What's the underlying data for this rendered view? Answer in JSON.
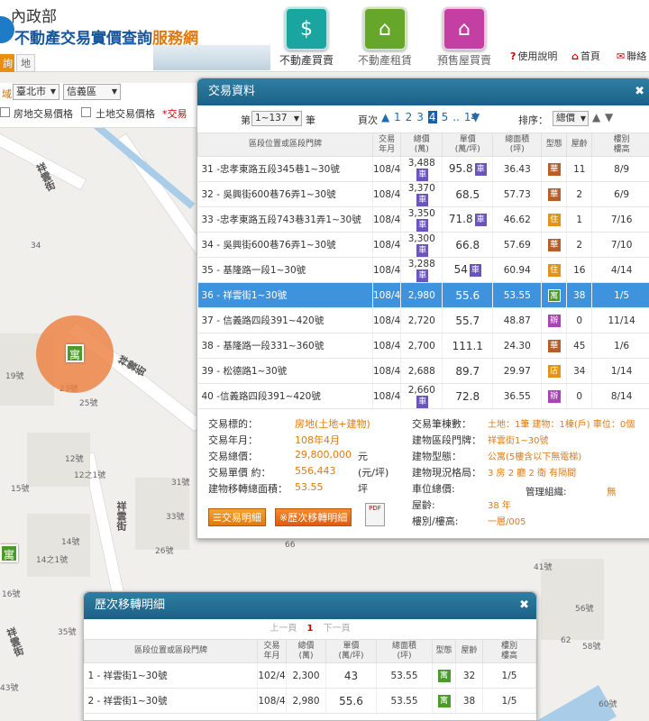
{
  "header": {
    "ministry": "內政部",
    "title_main": "不動產交易實價查詢",
    "title_accent": "服務網",
    "nav": [
      {
        "label": "不動產買賣",
        "color": "#1aa5a0",
        "icon": "building-dollar-icon",
        "glyph": "$"
      },
      {
        "label": "不動產租賃",
        "color": "#66a62b",
        "icon": "house-rent-icon",
        "glyph": "⌂"
      },
      {
        "label": "預售屋買賣",
        "color": "#c43fa4",
        "icon": "presale-crane-icon",
        "glyph": "⌂"
      }
    ],
    "links": [
      {
        "label": "使用說明",
        "glyph": "?"
      },
      {
        "label": "首頁",
        "glyph": "⌂"
      },
      {
        "label": "聯絡",
        "glyph": "✉"
      }
    ],
    "tabs": [
      "詢",
      "地標查詢"
    ]
  },
  "controls": {
    "area_label": "域",
    "city": "臺北市",
    "district": "信義區",
    "check1": "房地交易價格",
    "check2": "土地交易價格",
    "note": "*交易"
  },
  "map": {
    "streets": [
      "祥雲街",
      "祥雲街",
      "祥雲街",
      "祥雲街"
    ],
    "numbers": [
      "34",
      "19號",
      "23號",
      "25號",
      "12號",
      "12之1號",
      "15號",
      "31號",
      "33號",
      "14號",
      "14之1號",
      "26號",
      "16號",
      "35號",
      "41號",
      "56號",
      "58號",
      "62",
      "60號",
      "66",
      "43號"
    ]
  },
  "trade": {
    "title": "交易資料",
    "page_prefix": "第",
    "page_range": "1~137",
    "page_suffix": "筆",
    "pager_label": "頁次",
    "pages": [
      "1",
      "2",
      "3",
      "4",
      "5",
      "..",
      "14"
    ],
    "current_page": "4",
    "sort_label": "排序：",
    "sort_value": "總價",
    "columns": [
      "區段位置或區段門牌",
      "交易\n年月",
      "總價\n(萬)",
      "單價\n(萬/坪)",
      "總面積\n(坪)",
      "型態",
      "屋齡",
      "樓別\n樓高"
    ],
    "rows": [
      {
        "addr": "31 -忠孝東路五段345巷1~30號",
        "date": "108/4",
        "total": "3,488",
        "car": true,
        "unit": "95.8",
        "unitcar": true,
        "area": "36.43",
        "type": "華",
        "tcolor": "#b5602a",
        "age": "11",
        "floor": "8/9",
        "sel": false
      },
      {
        "addr": "32 - 吳興街600巷76弄1~30號",
        "date": "108/4",
        "total": "3,370",
        "car": true,
        "unit": "68.5",
        "unitcar": false,
        "area": "57.73",
        "type": "華",
        "tcolor": "#b5602a",
        "age": "2",
        "floor": "6/9",
        "sel": false
      },
      {
        "addr": "33 -忠孝東路五段743巷31弄1~30號",
        "date": "108/4",
        "total": "3,350",
        "car": true,
        "unit": "71.8",
        "unitcar": true,
        "area": "46.62",
        "type": "住",
        "tcolor": "#e0951a",
        "age": "1",
        "floor": "7/16",
        "sel": false
      },
      {
        "addr": "34 - 吳興街600巷76弄1~30號",
        "date": "108/4",
        "total": "3,300",
        "car": true,
        "unit": "66.8",
        "unitcar": false,
        "area": "57.69",
        "type": "華",
        "tcolor": "#b5602a",
        "age": "2",
        "floor": "7/10",
        "sel": false
      },
      {
        "addr": "35 - 基隆路一段1~30號",
        "date": "108/4",
        "total": "3,288",
        "car": true,
        "unit": "54",
        "unitcar": true,
        "area": "60.94",
        "type": "住",
        "tcolor": "#e0951a",
        "age": "16",
        "floor": "4/14",
        "sel": false
      },
      {
        "addr": "36 - 祥雲街1~30號",
        "date": "108/4",
        "total": "2,980",
        "car": false,
        "unit": "55.6",
        "unitcar": false,
        "area": "53.55",
        "type": "寓",
        "tcolor": "#4c9a2a",
        "age": "38",
        "floor": "1/5",
        "sel": true
      },
      {
        "addr": "37 - 信義路四段391~420號",
        "date": "108/4",
        "total": "2,720",
        "car": false,
        "unit": "55.7",
        "unitcar": false,
        "area": "48.87",
        "type": "辦",
        "tcolor": "#a745b0",
        "age": "0",
        "floor": "11/14",
        "sel": false
      },
      {
        "addr": "38 - 基隆路一段331~360號",
        "date": "108/4",
        "total": "2,700",
        "car": false,
        "unit": "111.1",
        "unitcar": false,
        "area": "24.30",
        "type": "華",
        "tcolor": "#b5602a",
        "age": "45",
        "floor": "1/6",
        "sel": false
      },
      {
        "addr": "39 - 松德路1~30號",
        "date": "108/4",
        "total": "2,688",
        "car": false,
        "unit": "89.7",
        "unitcar": false,
        "area": "29.97",
        "type": "店",
        "tcolor": "#e0951a",
        "age": "34",
        "floor": "1/14",
        "sel": false
      },
      {
        "addr": "40 -信義路四段391~420號",
        "date": "108/4",
        "total": "2,660",
        "car": true,
        "unit": "72.8",
        "unitcar": false,
        "area": "36.55",
        "type": "辦",
        "tcolor": "#a745b0",
        "age": "0",
        "floor": "8/14",
        "sel": false
      }
    ],
    "car_label": "車",
    "detail_left": [
      {
        "label": "交易標的：",
        "value": "房地(土地+建物)",
        "unit": ""
      },
      {
        "label": "交易年月：",
        "value": "108年4月",
        "unit": ""
      },
      {
        "label": "交易總價：",
        "value": "29,800,000",
        "unit": "元"
      },
      {
        "label": "交易單價 約：",
        "value": "556,443",
        "unit": "(元/坪)"
      },
      {
        "label": "建物移轉總面積：",
        "value": "53.55",
        "unit": "坪"
      }
    ],
    "detail_right": [
      {
        "label": "交易筆棟數：",
        "value": "土地：1筆 建物：1棟(戶) 車位：0個"
      },
      {
        "label": "建物區段門牌：",
        "value": "祥雲街1~30號"
      },
      {
        "label": "建物型態：",
        "value": "公寓(5樓含以下無電梯)"
      },
      {
        "label": "建物現況格局：",
        "value": "3 房 2 廳 2 衛 有隔間"
      },
      {
        "label": "車位總價:",
        "value": ""
      },
      {
        "label": "屋齡:",
        "value": "38 年"
      },
      {
        "label": "樓別/樓高:",
        "value": "一層/005"
      }
    ],
    "mgmt_label": "管理組織:",
    "mgmt_value": "無",
    "btn_detail": "交易明細",
    "btn_history": "※歷次移轉明細",
    "pdf_label": "PDF"
  },
  "history": {
    "title": "歷次移轉明細",
    "prev": "上一頁",
    "page": "1",
    "next": "下一頁",
    "columns": [
      "區段位置或區段門牌",
      "交易\n年月",
      "總價\n(萬)",
      "單價\n(萬/坪)",
      "總面積\n(坪)",
      "型態",
      "屋齡",
      "樓別\n樓高"
    ],
    "rows": [
      {
        "addr": "1 - 祥雲街1~30號",
        "date": "102/4",
        "total": "2,300",
        "unit": "43",
        "area": "53.55",
        "type": "寓",
        "age": "32",
        "floor": "1/5"
      },
      {
        "addr": "2 - 祥雲街1~30號",
        "date": "108/4",
        "total": "2,980",
        "unit": "55.6",
        "area": "53.55",
        "type": "寓",
        "age": "38",
        "floor": "1/5"
      }
    ]
  },
  "map_marker": "寓"
}
